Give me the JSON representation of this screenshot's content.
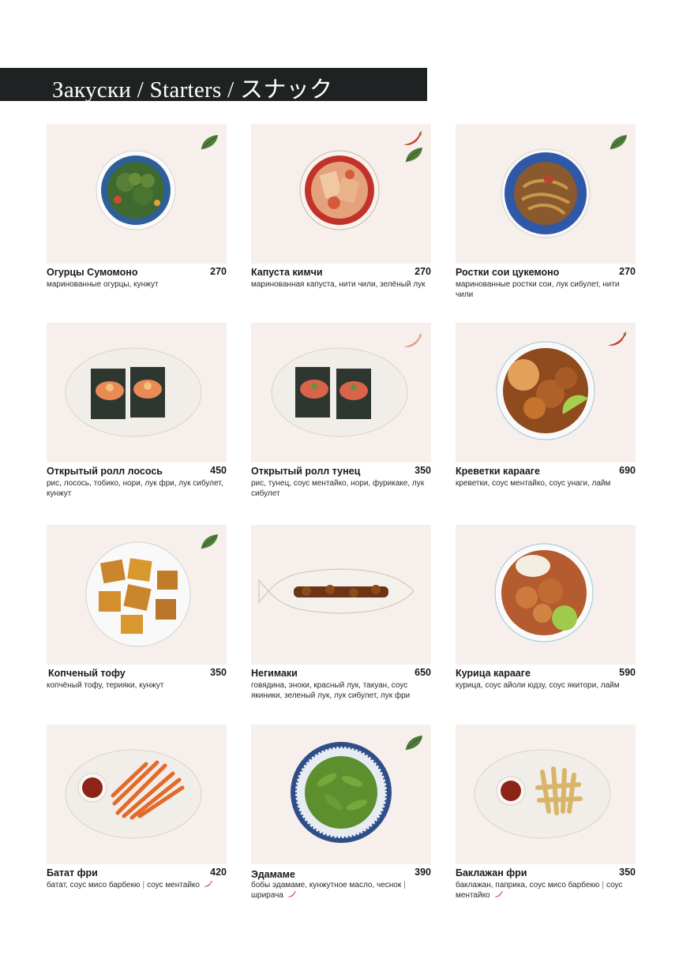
{
  "section_title": "Закуски / Starters / スナック",
  "colors": {
    "leaf": "#4e7d3a",
    "chili": "#c8402a",
    "chili_light": "#e79a8a",
    "bar": "#1f2223",
    "photo_bg": "#f6efeb"
  },
  "items": [
    {
      "name": "Огурцы Сумомоно",
      "price": "270",
      "description": "маринованные огурцы, кунжут",
      "icons": [
        "leaf-icon"
      ]
    },
    {
      "name": "Капуста кимчи",
      "price": "270",
      "description": "маринованная капуста, нити чили, зелёный лук",
      "icons": [
        "chili-icon",
        "leaf-icon"
      ]
    },
    {
      "name": "Ростки сои цукемоно",
      "price": "270",
      "description": "маринованные ростки сои, лук сибулет, нити чили",
      "icons": [
        "leaf-icon"
      ]
    },
    {
      "name": "Открытый ролл лосось",
      "price": "450",
      "description": "рис, лосось, тобико, нори, лук фри, лук сибулет, кунжут",
      "icons": []
    },
    {
      "name": "Открытый ролл тунец",
      "price": "350",
      "description": "рис, тунец, соус ментайко, нори, фурикаке, лук сибулет",
      "icons": [
        "chili-light-icon"
      ]
    },
    {
      "name": "Креветки карааге",
      "price": "690",
      "description": "креветки, соус ментайко, соус унаги, лайм",
      "icons": [
        "chili-icon"
      ]
    },
    {
      "name": "Копченый тофу",
      "price": "350",
      "description": "копчёный тофу, терияки, кунжут",
      "icons": [
        "leaf-icon"
      ]
    },
    {
      "name": "Негимаки",
      "price": "650",
      "description": "говядина, эноки, красный лук, такуан, соус якиники, зеленый лук, лук сибулет, лук фри",
      "icons": []
    },
    {
      "name": "Курица карааге",
      "price": "590",
      "description": "курица, соус айоли юдзу, соус якитори, лайм",
      "icons": []
    },
    {
      "name": "Батат фри",
      "price": "420",
      "description": "батат, соус мисо барбекю",
      "description_extra": "соус ментайко",
      "icons": []
    },
    {
      "name": "Эдамаме",
      "price": "390",
      "description": "бобы эдамаме, кунжутное масло, чеснок",
      "description_extra": "шрирача",
      "icons": [
        "leaf-icon"
      ]
    },
    {
      "name": "Баклажан фри",
      "price": "350",
      "description": "баклажан, паприка, соус мисо барбекю",
      "description_extra": "соус ментайко",
      "icons": []
    }
  ]
}
